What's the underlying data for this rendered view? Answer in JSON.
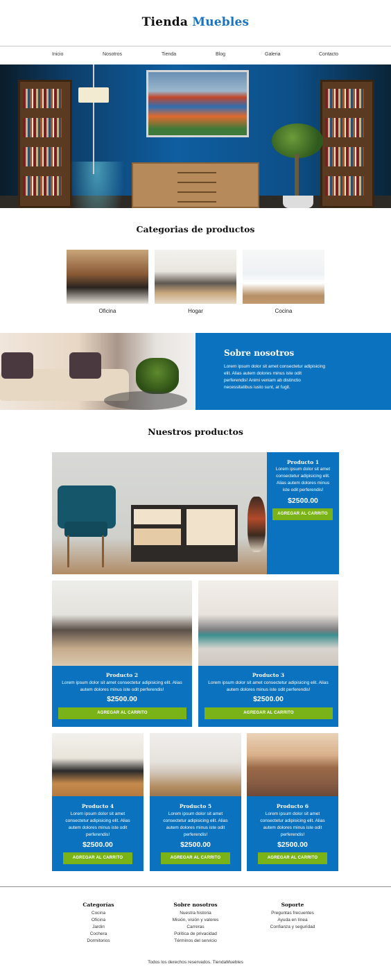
{
  "site": {
    "brand_part1": "Tienda",
    "brand_part2": "Muebles",
    "brand_color": "#1a73c0",
    "accent_blue": "#0a72be",
    "accent_green": "#7ab317"
  },
  "nav": {
    "items": [
      "Inicio",
      "Nosotros",
      "Tienda",
      "Blog",
      "Galeria",
      "Contacto"
    ]
  },
  "categories": {
    "title": "Categorias de productos",
    "items": [
      {
        "label": "Oficina"
      },
      {
        "label": "Hogar"
      },
      {
        "label": "Cocina"
      }
    ]
  },
  "about": {
    "title": "Sobre nosotros",
    "text": "Lorem ipsum dolor sit amet consectetur adipisicing elit. Alias autem dolores minus iste odit perferendis! Animi veniam ab distinctio necessitatibus iusto sunt, at fugit."
  },
  "products": {
    "title": "Nuestros productos",
    "cart_label": "AGREGAR AL CARRITO",
    "items": [
      {
        "name": "Producto 1",
        "desc": "Lorem ipsum dolor sit amet consectetur adipisicing elit. Alias autem dolores minus iste odit perferendis!",
        "price": "$2500.00"
      },
      {
        "name": "Producto 2",
        "desc": "Lorem ipsum dolor sit amet consectetur adipisicing elit. Alias autem dolores minus iste odit perferendis!",
        "price": "$2500.00"
      },
      {
        "name": "Producto 3",
        "desc": "Lorem ipsum dolor sit amet consectetur adipisicing elit. Alias autem dolores minus iste odit perferendis!",
        "price": "$2500.00"
      },
      {
        "name": "Producto 4",
        "desc": "Lorem ipsum dolor sit amet consectetur adipisicing elit. Alias autem dolores minus iste odit perferendis!",
        "price": "$2500.00"
      },
      {
        "name": "Producto 5",
        "desc": "Lorem ipsum dolor sit amet consectetur adipisicing elit. Alias autem dolores minus iste odit perferendis!",
        "price": "$2500.00"
      },
      {
        "name": "Producto 6",
        "desc": "Lorem ipsum dolor sit amet consectetur adipisicing elit. Alias autem dolores minus iste odit perferendis!",
        "price": "$2500.00"
      }
    ]
  },
  "footer": {
    "columns": [
      {
        "title": "Categorías",
        "links": [
          "Cocina",
          "Oficina",
          "Jardin",
          "Cochera",
          "Dormitorios"
        ]
      },
      {
        "title": "Sobre nosotros",
        "links": [
          "Nuestra historia",
          "Misión, visión y valores",
          "Carreras",
          "Política de privacidad",
          "Términos del servicio"
        ]
      },
      {
        "title": "Soporte",
        "links": [
          "Preguntas frecuentes",
          "Ayuda en línea",
          "Confianza y seguridad"
        ]
      }
    ],
    "copyright": "Todos los derechos reservados. TiendaMuebles"
  }
}
